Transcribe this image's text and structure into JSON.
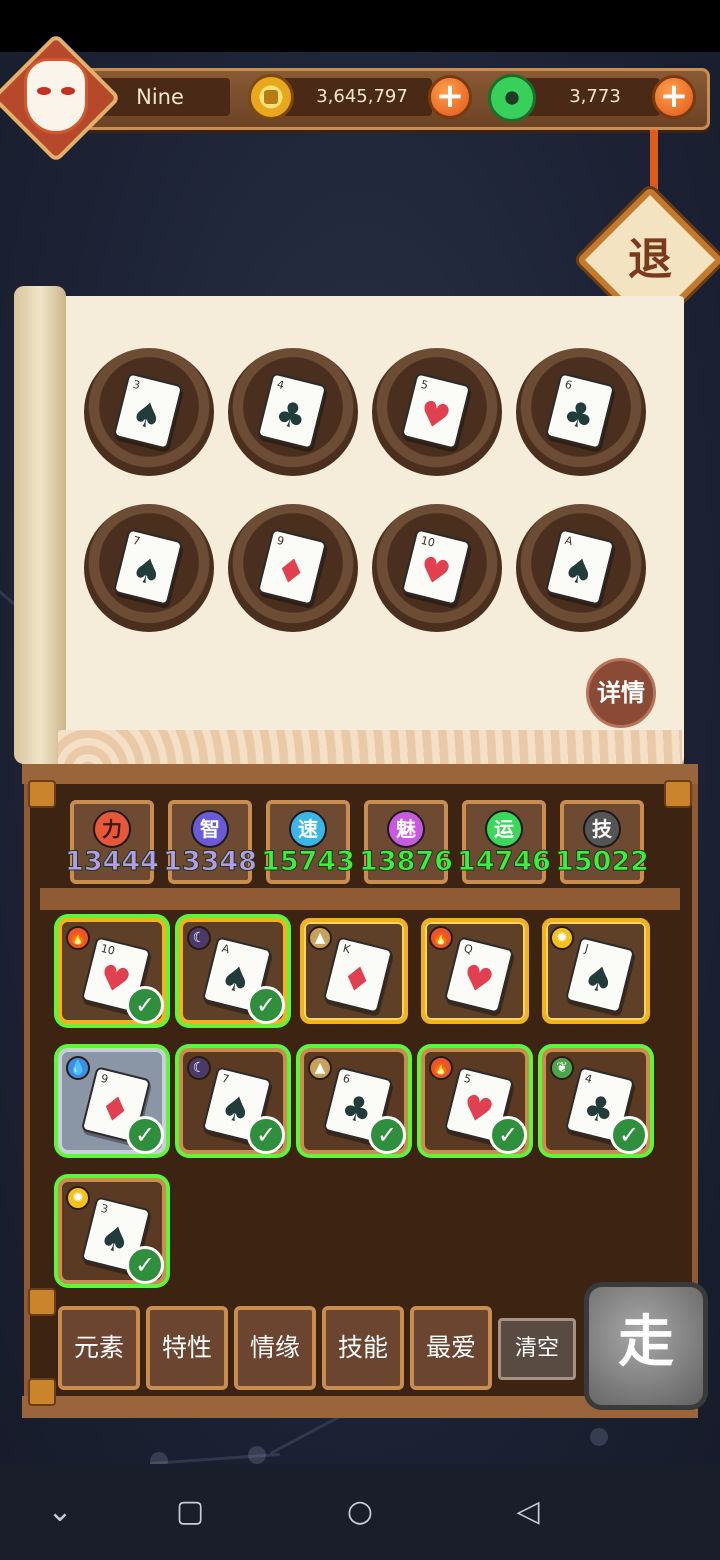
{
  "player": {
    "name": "Nine"
  },
  "currency": {
    "coins": "3,645,797",
    "jade": "3,773"
  },
  "header": {
    "retreat_label": "退"
  },
  "board": {
    "cards": [
      {
        "rank": "3",
        "suit": "♠",
        "color": "black"
      },
      {
        "rank": "4",
        "suit": "♣",
        "color": "black"
      },
      {
        "rank": "5",
        "suit": "♥",
        "color": "red"
      },
      {
        "rank": "6",
        "suit": "♣",
        "color": "black"
      },
      {
        "rank": "7",
        "suit": "♠",
        "color": "black"
      },
      {
        "rank": "9",
        "suit": "♦",
        "color": "red"
      },
      {
        "rank": "10",
        "suit": "♥",
        "color": "red"
      },
      {
        "rank": "A",
        "suit": "♠",
        "color": "black"
      }
    ],
    "details_label": "详情"
  },
  "stats": [
    {
      "label": "力",
      "value": "13444",
      "icon_color": "#e8573a",
      "value_color": "#b59bf0"
    },
    {
      "label": "智",
      "value": "13348",
      "icon_color": "#6a5ad8",
      "value_color": "#b59bf0"
    },
    {
      "label": "速",
      "value": "15743",
      "icon_color": "#3ab6e8",
      "value_color": "#3cf03a"
    },
    {
      "label": "魅",
      "value": "13876",
      "icon_color": "#c85ae0",
      "value_color": "#3cf03a"
    },
    {
      "label": "运",
      "value": "14746",
      "icon_color": "#3ad85a",
      "value_color": "#3cf03a"
    },
    {
      "label": "技",
      "value": "15022",
      "icon_color": "#555555",
      "value_color": "#3cf03a"
    }
  ],
  "inventory": [
    {
      "rank": "10",
      "suit": "♥",
      "color": "red",
      "element": "fire-icon",
      "selected": true,
      "frame": "gold"
    },
    {
      "rank": "A",
      "suit": "♠",
      "color": "black",
      "element": "moon-icon",
      "selected": true,
      "frame": "gold"
    },
    {
      "rank": "K",
      "suit": "♦",
      "color": "red",
      "element": "earth-icon",
      "selected": false,
      "frame": "gold"
    },
    {
      "rank": "Q",
      "suit": "♥",
      "color": "red",
      "element": "fire-icon",
      "selected": false,
      "frame": "gold"
    },
    {
      "rank": "J",
      "suit": "♠",
      "color": "black",
      "element": "sun-icon",
      "selected": false,
      "frame": "gold"
    },
    {
      "rank": "9",
      "suit": "♦",
      "color": "red",
      "element": "water-icon",
      "selected": true,
      "frame": "ice"
    },
    {
      "rank": "7",
      "suit": "♠",
      "color": "black",
      "element": "moon-icon",
      "selected": true,
      "frame": "wood"
    },
    {
      "rank": "6",
      "suit": "♣",
      "color": "black",
      "element": "earth-icon",
      "selected": true,
      "frame": "wood"
    },
    {
      "rank": "5",
      "suit": "♥",
      "color": "red",
      "element": "fire-icon",
      "selected": true,
      "frame": "wood"
    },
    {
      "rank": "4",
      "suit": "♣",
      "color": "black",
      "element": "leaf-icon",
      "selected": true,
      "frame": "wood"
    },
    {
      "rank": "3",
      "suit": "♠",
      "color": "black",
      "element": "sun-icon",
      "selected": true,
      "frame": "wood"
    }
  ],
  "filters": [
    {
      "label": "元素"
    },
    {
      "label": "特性"
    },
    {
      "label": "情缘"
    },
    {
      "label": "技能"
    },
    {
      "label": "最爱"
    }
  ],
  "actions": {
    "clear_label": "清空",
    "go_label": "走"
  }
}
